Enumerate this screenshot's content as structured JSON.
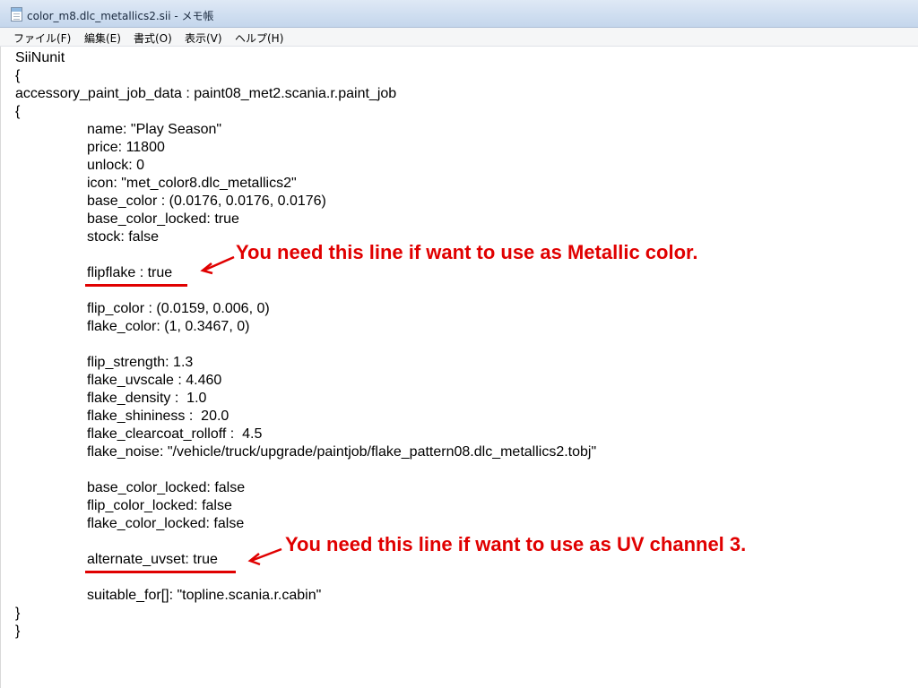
{
  "window": {
    "title": "color_m8.dlc_metallics2.sii - メモ帳"
  },
  "menu": [
    "ファイル(F)",
    "編集(E)",
    "書式(O)",
    "表示(V)",
    "ヘルプ(H)"
  ],
  "lines": {
    "l1": "SiiNunit",
    "l2": "{",
    "l3": "accessory_paint_job_data : paint08_met2.scania.r.paint_job",
    "l4": "{",
    "name": "name: \"Play Season\"",
    "price": "price: 11800",
    "unlock": "unlock: 0",
    "icon": "icon: \"met_color8.dlc_metallics2\"",
    "base_color": "base_color : (0.0176, 0.0176, 0.0176)",
    "base_color_locked_true": "base_color_locked: true",
    "stock": "stock: false",
    "flipflake": "flipflake : true",
    "flip_color": "flip_color : (0.0159, 0.006, 0)",
    "flake_color": "flake_color: (1, 0.3467, 0)",
    "flip_strength": "flip_strength: 1.3",
    "flake_uvscale": "flake_uvscale : 4.460",
    "flake_density": "flake_density :  1.0",
    "flake_shininess": "flake_shininess :  20.0",
    "flake_clearcoat_rolloff": "flake_clearcoat_rolloff :  4.5",
    "flake_noise": "flake_noise: \"/vehicle/truck/upgrade/paintjob/flake_pattern08.dlc_metallics2.tobj\"",
    "base_color_locked_false": "base_color_locked: false",
    "flip_color_locked": "flip_color_locked: false",
    "flake_color_locked": "flake_color_locked: false",
    "alternate_uvset": "alternate_uvset: true",
    "suitable_for": "suitable_for[]: \"topline.scania.r.cabin\"",
    "close1": "}",
    "close2": "}"
  },
  "annotations": {
    "metallic": "You need this line if want to use as Metallic color.",
    "uv": "You need this line if want to use as UV channel 3."
  },
  "colors": {
    "annotation": "#e00000"
  }
}
